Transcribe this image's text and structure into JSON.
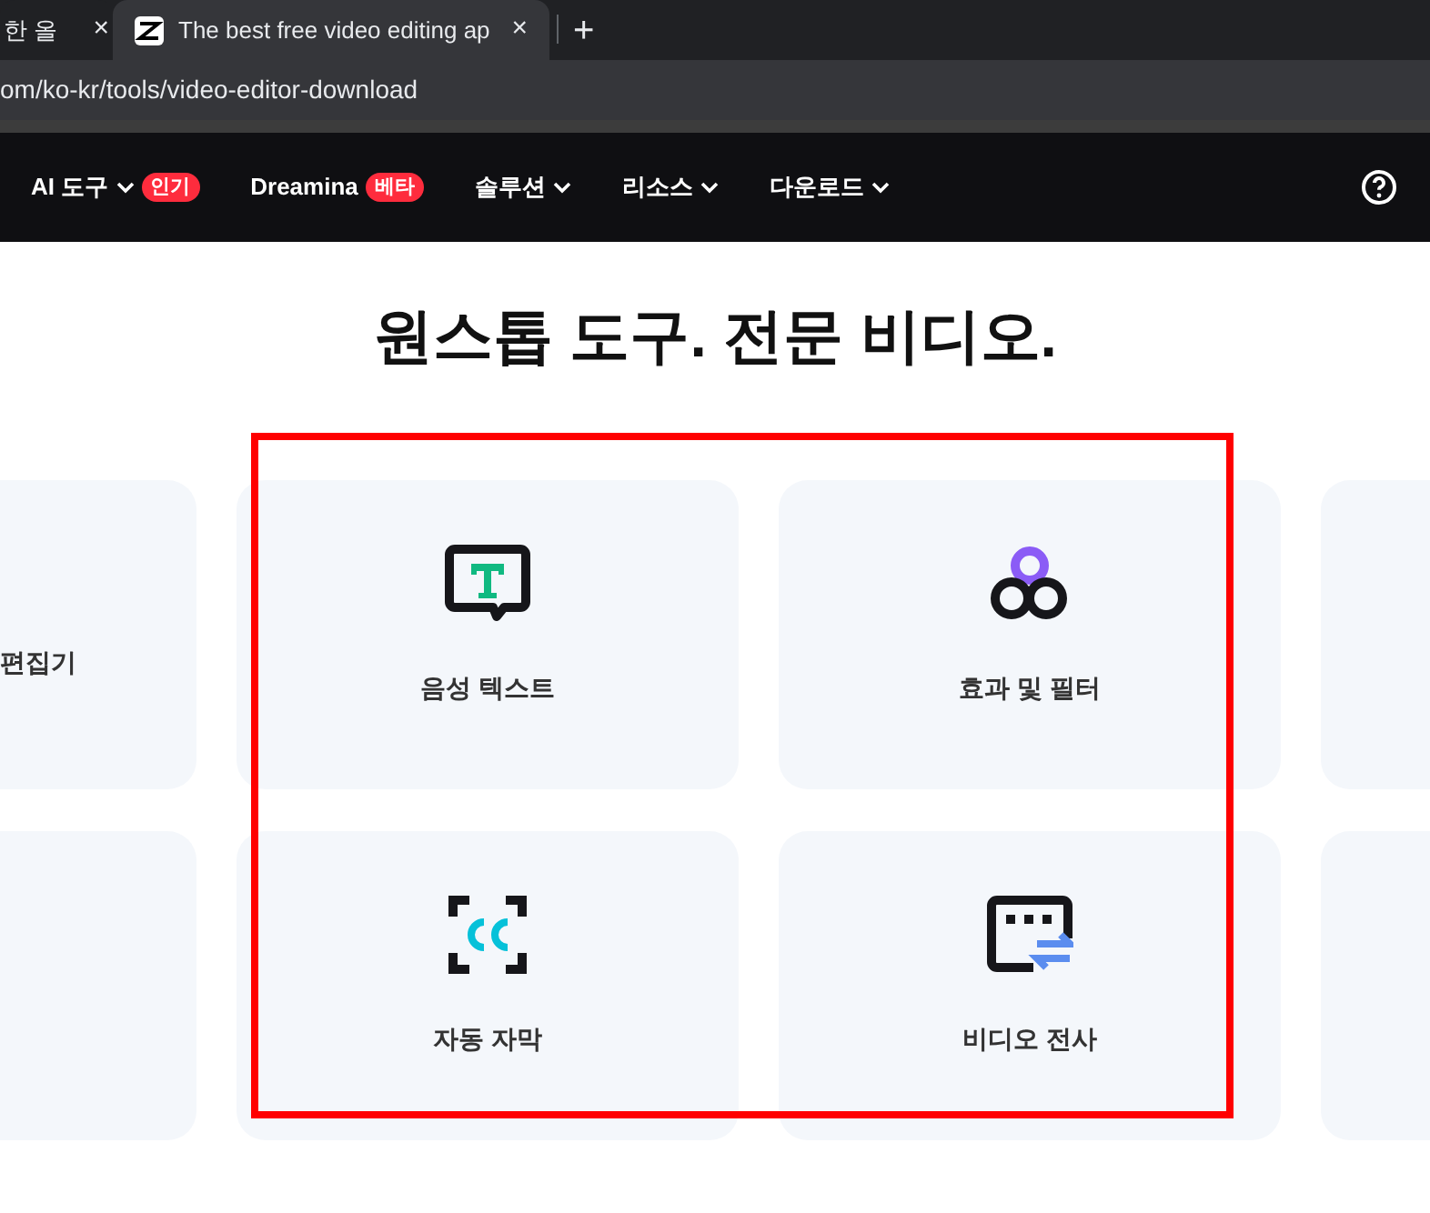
{
  "browser": {
    "tabs": [
      {
        "title": "한 올",
        "selected": false,
        "close": "×"
      },
      {
        "title": "The best free video editing ap",
        "selected": true,
        "close": "×"
      }
    ],
    "new_tab": "+",
    "url": "om/ko-kr/tools/video-editor-download"
  },
  "nav": {
    "items": [
      {
        "label": "AI 도구",
        "dropdown": true,
        "badge": "인기"
      },
      {
        "label": "Dreamina",
        "dropdown": false,
        "badge": "베타"
      },
      {
        "label": "솔루션",
        "dropdown": true
      },
      {
        "label": "리소스",
        "dropdown": true
      },
      {
        "label": "다운로드",
        "dropdown": true
      }
    ]
  },
  "heading": "원스톱 도구. 전문 비디오.",
  "rows": [
    {
      "left_label": "편집기",
      "cards": [
        {
          "kind": "speech",
          "label": "음성 텍스트"
        },
        {
          "kind": "effects",
          "label": "효과 및 필터"
        }
      ]
    },
    {
      "cards": [
        {
          "kind": "captions",
          "label": "자동 자막"
        },
        {
          "kind": "transcribe",
          "label": "비디오 전사"
        }
      ]
    }
  ]
}
